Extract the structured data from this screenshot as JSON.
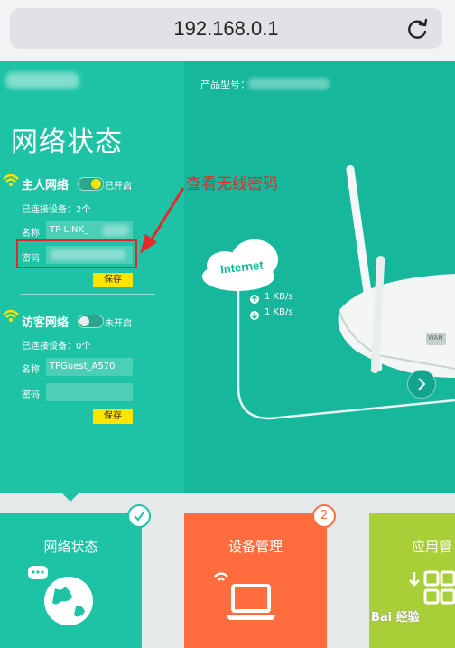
{
  "browser": {
    "url": "192.168.0.1"
  },
  "header": {
    "product_model_label": "产品型号："
  },
  "panel": {
    "title": "网络状态",
    "main_network": {
      "title": "主人网络",
      "toggle_state": "已开启",
      "connected_devices": "已连接设备：2个",
      "name_label": "名称",
      "name_value": "TP-LINK_",
      "password_label": "密码",
      "save_label": "保存"
    },
    "guest_network": {
      "title": "访客网络",
      "toggle_state": "未开启",
      "connected_devices": "已连接设备：0个",
      "name_label": "名称",
      "name_value": "TPGuest_A570",
      "password_label": "密码",
      "save_label": "保存"
    }
  },
  "annotation": {
    "text": "查看无线密码"
  },
  "illustration": {
    "cloud_label": "Internet",
    "upload_speed": "1 KB/s",
    "download_speed": "1 KB/s",
    "router_port_label": "WAN"
  },
  "tiles": [
    {
      "label": "网络状态",
      "color": "#1ec3a5"
    },
    {
      "label": "设备管理",
      "color": "#ff6d3f",
      "badge": "2"
    },
    {
      "label": "应用管",
      "color": "#a8cf37"
    }
  ],
  "watermark": "Bai 经验",
  "colors": {
    "accent": "#1ec3a5",
    "highlight": "#e5262b",
    "save_button": "#ffe400"
  }
}
